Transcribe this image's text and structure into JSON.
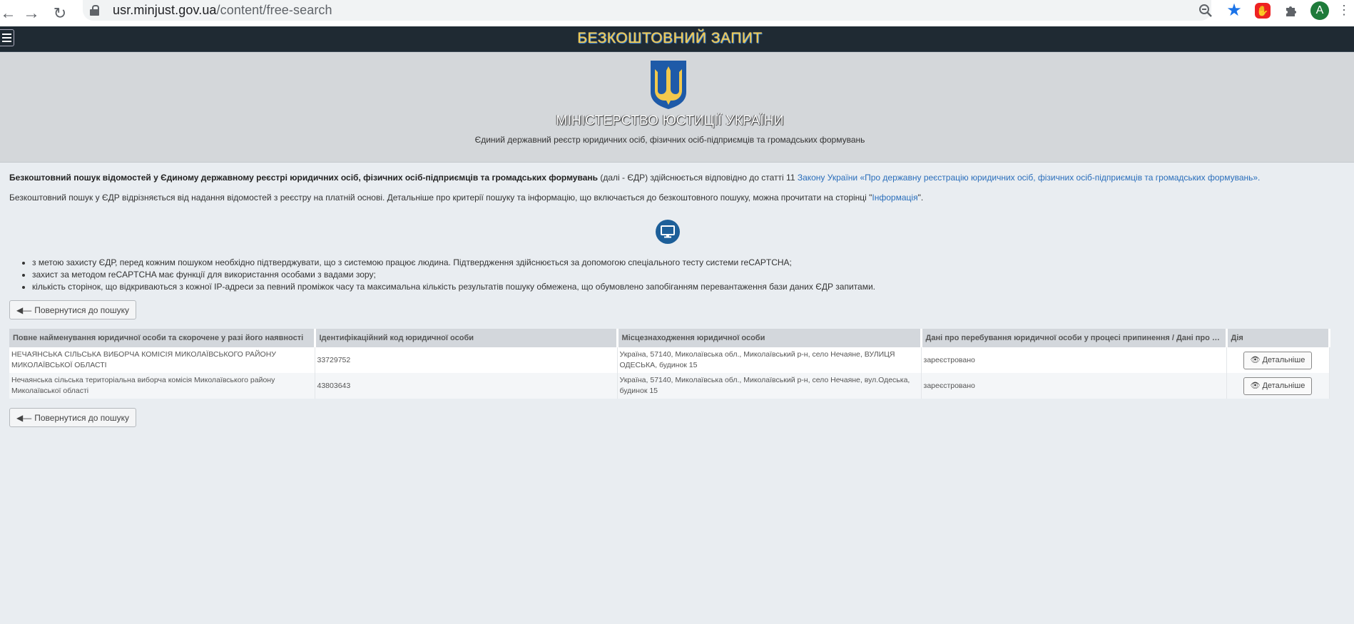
{
  "browser": {
    "url_host": "usr.minjust.gov.ua",
    "url_path": "/content/free-search",
    "back_icon": "arrow-left-icon",
    "forward_icon": "arrow-right-icon",
    "reload_icon": "reload-icon",
    "avatar_letter": "A"
  },
  "topnav": {
    "title": "БЕЗКОШТОВНИЙ ЗАПИТ"
  },
  "header": {
    "ministry": "МІНІСТЕРСТВО ЮСТИЦІЇ УКРАЇНИ",
    "registry": "Єдиний державний реєстр юридичних осіб, фізичних осіб-підприємців та громадських формувань"
  },
  "intro": {
    "bold": "Безкоштовний пошук відомостей у Єдиному державному реєстрі юридичних осіб, фізичних осіб-підприємців та громадських формувань",
    "middle": " (далі - ЄДР) здійснюється відповідно до статті 11 ",
    "law_link": "Закону України «Про державну реєстрацію юридичних осіб, фізичних осіб-підприємців та громадських формувань».",
    "line2_start": "Безкоштовний пошук у ЄДР відрізняється від надання відомостей з реєстру на платній основі. Детальніше про критерії пошуку та інформацію, що включається до безкоштовного пошуку, можна прочитати на сторінці \"",
    "info_link": "Інформація",
    "line2_end": "\"."
  },
  "bullets": [
    "з метою захисту ЄДР, перед кожним пошуком необхідно підтверджувати, що з системою працює людина. Підтвердження здійснюється за допомогою спеціального тесту системи reCAPTCHA;",
    "захист за методом reCAPTCHA має функції для використання особами з вадами зору;",
    "кількість сторінок, що відкриваються з кожної IP-адреси за певний проміжок часу та максимальна кількість результатів пошуку обмежена, що обумовлено запобіганням перевантаження бази даних ЄДР запитами."
  ],
  "back_button_label": "Повернутися до пошуку",
  "table": {
    "headers": [
      "Повне найменування юридичної особи та скорочене у разі його наявності",
      "Ідентифікаційний код юридичної особи",
      "Місцезнаходження юридичної особи",
      "Дані про перебування юридичної особи у процесі припинення / Дані про п...",
      "Дія"
    ],
    "rows": [
      {
        "name": "НЕЧАЯНСЬКА СІЛЬСЬКА ВИБОРЧА КОМІСІЯ МИКОЛАЇВСЬКОГО РАЙОНУ МИКОЛАЇВСЬКОЇ ОБЛАСТІ",
        "code": "33729752",
        "address": "Україна, 57140, Миколаївська обл., Миколаївський р-н, село Нечаяне, ВУЛИЦЯ ОДЕСЬКА, будинок 15",
        "status": "зареєстровано",
        "action": "Детальніше"
      },
      {
        "name": "Нечаянська сільська територіальна виборча комісія Миколаївського району Миколаївської області",
        "code": "43803643",
        "address": "Україна, 57140, Миколаївська обл., Миколаївський р-н, село Нечаяне, вул.Одеська, будинок 15",
        "status": "зареєстровано",
        "action": "Детальніше"
      }
    ]
  }
}
